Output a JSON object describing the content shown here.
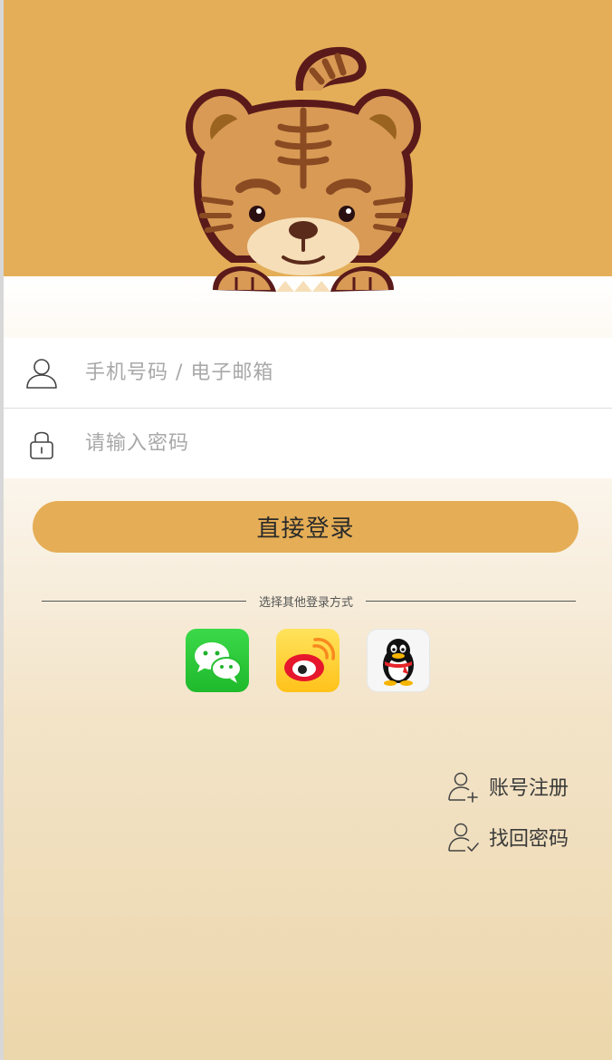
{
  "login_form": {
    "phone_placeholder": "手机号码 / 电子邮箱",
    "password_placeholder": "请输入密码",
    "submit_label": "直接登录"
  },
  "other_login": {
    "divider_text": "选择其他登录方式",
    "providers": [
      {
        "name": "wechat",
        "icon": "wechat-icon"
      },
      {
        "name": "weibo",
        "icon": "weibo-icon"
      },
      {
        "name": "qq",
        "icon": "qq-icon"
      }
    ]
  },
  "links": {
    "register_label": "账号注册",
    "register_icon": "user-add-icon",
    "forgot_label": "找回密码",
    "forgot_icon": "user-check-icon"
  },
  "colors": {
    "brand": "#e4ae59",
    "button": "#e5ae56",
    "background_bottom": "#ecd6ab"
  }
}
